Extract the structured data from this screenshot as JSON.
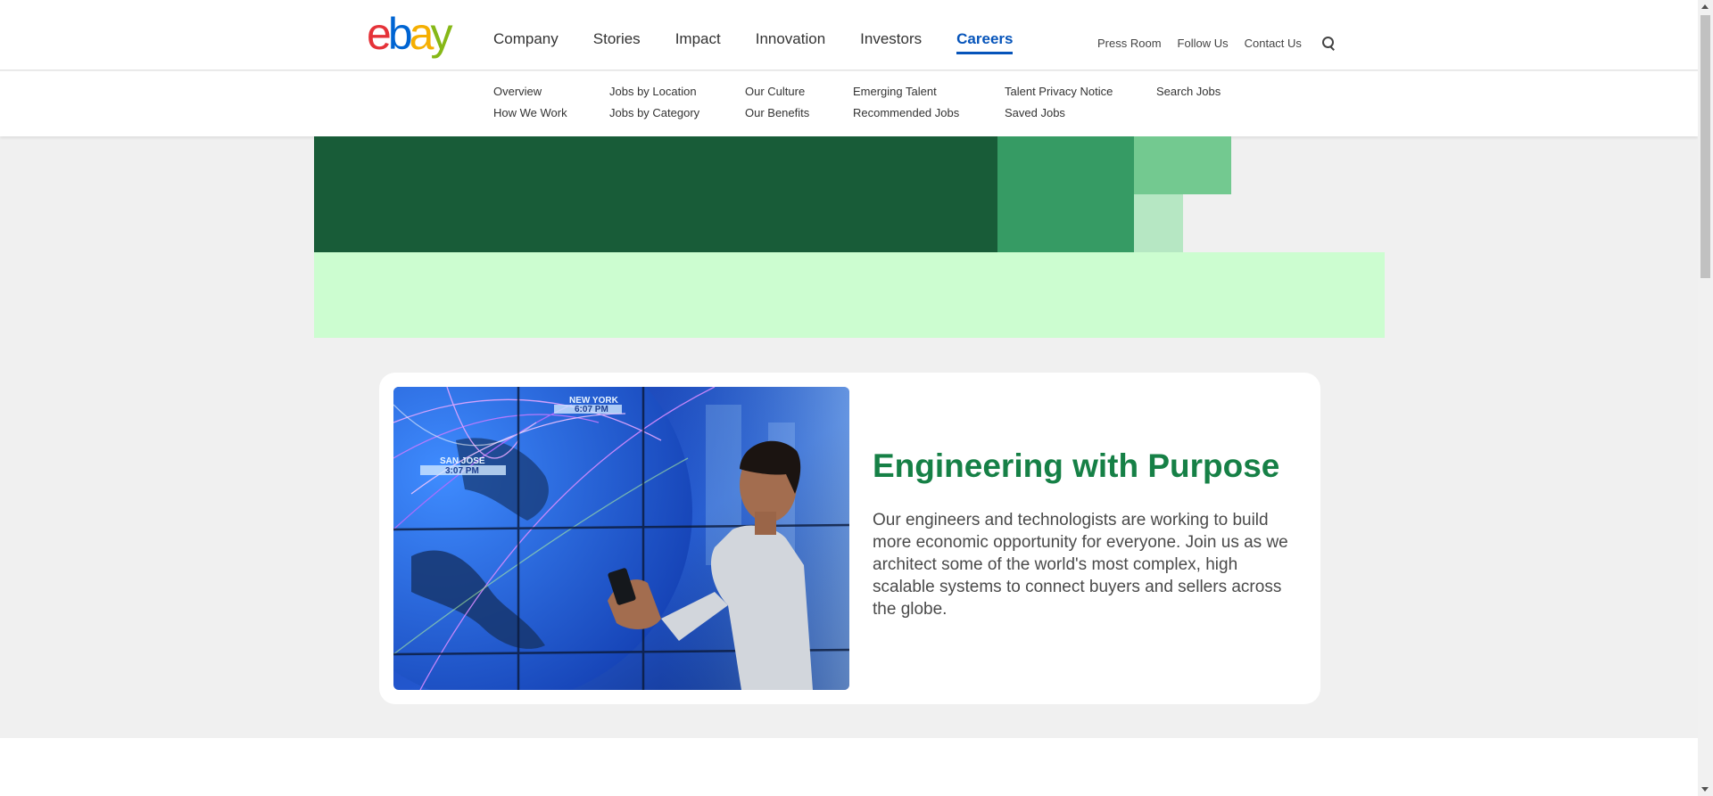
{
  "header": {
    "logo_text": "ebay",
    "nav": [
      {
        "label": "Company"
      },
      {
        "label": "Stories"
      },
      {
        "label": "Impact"
      },
      {
        "label": "Innovation"
      },
      {
        "label": "Investors"
      },
      {
        "label": "Careers",
        "active": true
      }
    ],
    "utility": [
      {
        "label": "Press Room"
      },
      {
        "label": "Follow Us"
      },
      {
        "label": "Contact Us"
      }
    ],
    "search_icon": "search-icon"
  },
  "subnav": {
    "columns": [
      [
        "Overview",
        "How We Work"
      ],
      [
        "Jobs by Location",
        "Jobs by Category"
      ],
      [
        "Our Culture",
        "Our Benefits"
      ],
      [
        "Emerging Talent",
        "Recommended Jobs"
      ],
      [
        "Talent Privacy Notice",
        "Saved Jobs"
      ],
      [
        "Search Jobs"
      ]
    ]
  },
  "hero": {
    "colors": {
      "dark": "#185c38",
      "mid": "#369b64",
      "light": "#73c990",
      "pale": "#b6e7c3",
      "mint": "#ccfdd0"
    }
  },
  "feature": {
    "title": "Engineering with Purpose",
    "body": "Our engineers and technologists are working to build more economic opportunity for everyone. Join us as we architect some of the world's most complex, high scalable systems to connect buyers and sellers across the globe.",
    "image": {
      "label_top": "NEW YORK",
      "time_top": "6:07 PM",
      "label_left": "SAN JOSE",
      "time_left": "3:07 PM"
    }
  },
  "colors": {
    "accent_blue": "#0654ba",
    "title_green": "#168046"
  }
}
